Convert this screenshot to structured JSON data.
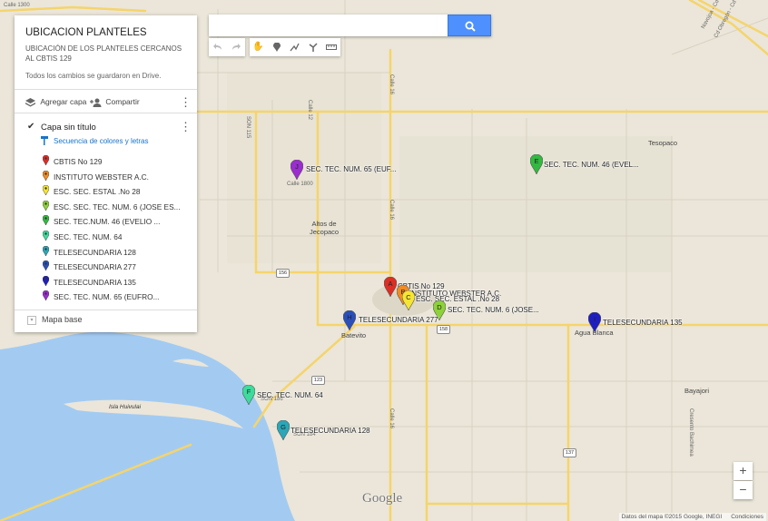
{
  "panel": {
    "title": "UBICACION PLANTELES",
    "description": "UBICACIÓN DE LOS PLANTELES CERCANOS AL CBTIS 129",
    "saved_status": "Todos los cambios se guardaron en Drive.",
    "add_layer_label": "Agregar capa",
    "share_label": "Compartir",
    "layer_name": "Capa sin título",
    "style_link": "Secuencia de colores y letras",
    "base_map_label": "Mapa base",
    "items": [
      {
        "label": "CBTIS No 129",
        "color": "#db2e25"
      },
      {
        "label": "INSTITUTO WEBSTER A.C.",
        "color": "#f08c23"
      },
      {
        "label": "ESC. SEC. ESTAL .No 28",
        "color": "#f5e535"
      },
      {
        "label": "ESC. SEC. TEC. NUM. 6 (JOSE ES...",
        "color": "#8dd23a"
      },
      {
        "label": "SEC. TEC.NUM. 46 (EVELIO ...",
        "color": "#33b940"
      },
      {
        "label": "SEC. TEC. NUM. 64",
        "color": "#3ddc9c"
      },
      {
        "label": "TELESECUNDARIA 128",
        "color": "#2aa7b8"
      },
      {
        "label": "TELESECUNDARIA 277",
        "color": "#2b4fb8"
      },
      {
        "label": "TELESECUNDARIA 135",
        "color": "#1f1fbf"
      },
      {
        "label": "SEC. TEC. NUM. 65 (EUFRO...",
        "color": "#9b2ccf"
      }
    ]
  },
  "search": {
    "placeholder": "",
    "value": ""
  },
  "markers": [
    {
      "letter": "A",
      "label": "CBTIS No 129",
      "color": "#db2e25"
    },
    {
      "letter": "B",
      "label": "INSTITUTO WEBSTER A.C.",
      "color": "#f08c23"
    },
    {
      "letter": "C",
      "label": "ESC. SEC. ESTAL .No 28",
      "color": "#f5e535"
    },
    {
      "letter": "D",
      "label": "SEC. TEC. NUM. 6 (JOSE...",
      "color": "#8dd23a"
    },
    {
      "letter": "E",
      "label": "SEC. TEC. NUM. 46 (EVEL...",
      "color": "#33b940"
    },
    {
      "letter": "F",
      "label": "SEC. TEC. NUM. 64",
      "color": "#3ddc9c"
    },
    {
      "letter": "G",
      "label": "TELESECUNDARIA 128",
      "color": "#2aa7b8"
    },
    {
      "letter": "H",
      "label": "TELESECUNDARIA 277",
      "color": "#2b4fb8"
    },
    {
      "letter": "I",
      "label": "TELESECUNDARIA 135",
      "color": "#1f1fbf"
    },
    {
      "letter": "J",
      "label": "SEC. TEC. NUM. 65 (EUF...",
      "color": "#9b2ccf"
    }
  ],
  "places": {
    "altos": "Altos de\nJecopaco",
    "batevito": "Batevito",
    "agua_blanca": "Agua Blanca",
    "tesopaco": "Tesopaco",
    "bayajori": "Bayajori",
    "isla": "Isla Huivulai"
  },
  "road_labels": {
    "calle1300": "Calle 1300",
    "calle16a": "Calle 16",
    "calle16b": "Calle 16",
    "calle16c": "Calle 16",
    "calle12": "Calle 12",
    "son115": "SON 115",
    "calle1800": "Calle 1800",
    "son186": "SON 186",
    "son184": "SON 184",
    "obregon1": "Cd Obregón - Cd Obregón",
    "obregon2": "Navojoa - Cd Obregón",
    "bachimea": "Cresento Bachimea"
  },
  "shields": {
    "s156": "156",
    "s158": "158",
    "s123": "123",
    "s137": "137"
  },
  "zoom": {
    "in": "+",
    "out": "−"
  },
  "attribution": {
    "data": "Datos del mapa ©2015 Google, INEGI",
    "terms": "Condiciones"
  },
  "logo": "Google"
}
